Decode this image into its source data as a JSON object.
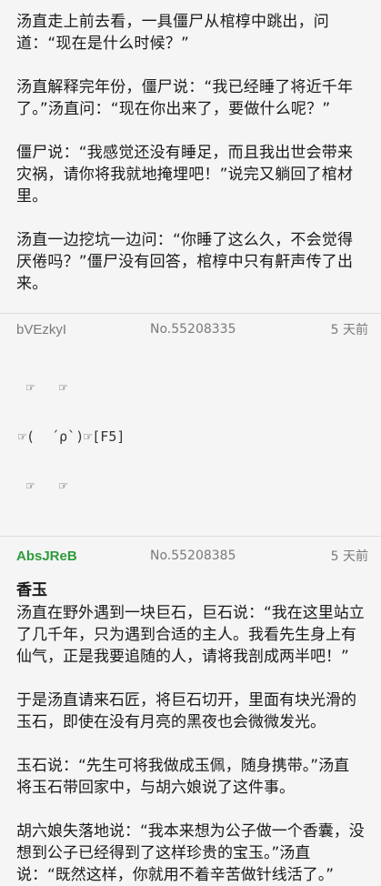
{
  "story": {
    "paragraphs": [
      "汤直走上前去看，一具僵尸从棺椁中跳出，问道：“现在是什么时候？”",
      "汤直解释完年份，僵尸说：“我已经睡了将近千年了。”汤直问：“现在你出来了，要做什么呢？”",
      "僵尸说：“我感觉还没有睡足，而且我出世会带来灾祸，请你将我就地掩埋吧！”说完又躺回了棺材里。",
      "汤直一边挖坑一边问：“你睡了这么久，不会觉得厌倦吗？”僵尸没有回答，棺椁中只有鼾声传了出来。"
    ]
  },
  "replies": [
    {
      "user_id": "bVEzkyI",
      "number": "No.55208335",
      "time": "5 天前",
      "kaomoji": [
        " ☞   ☞",
        "☞(  ´ρ`)☞[F5]",
        " ☞   ☞"
      ]
    },
    {
      "user_id": "AbsJReB",
      "number": "No.55208385",
      "time": "5 天前",
      "title": "香玉",
      "paragraphs": [
        "汤直在野外遇到一块巨石，巨石说：“我在这里站立了几千年，只为遇到合适的主人。我看先生身上有仙气，正是我要追随的人，请将我剖成两半吧！”",
        "于是汤直请来石匠，将巨石切开，里面有块光滑的玉石，即使在没有月亮的黑夜也会微微发光。",
        "玉石说：“先生可将我做成玉佩，随身携带。”汤直将玉石带回家中，与胡六娘说了这件事。",
        "胡六娘失落地说：“我本来想为公子做一个香囊，没想到公子已经得到了这样珍贵的宝玉。”汤直说：“既然这样，你就用不着辛苦做针线活了。”"
      ]
    }
  ],
  "colors": {
    "uid_green": "#2e9b3c",
    "meta_gray": "#7a7a7a"
  }
}
